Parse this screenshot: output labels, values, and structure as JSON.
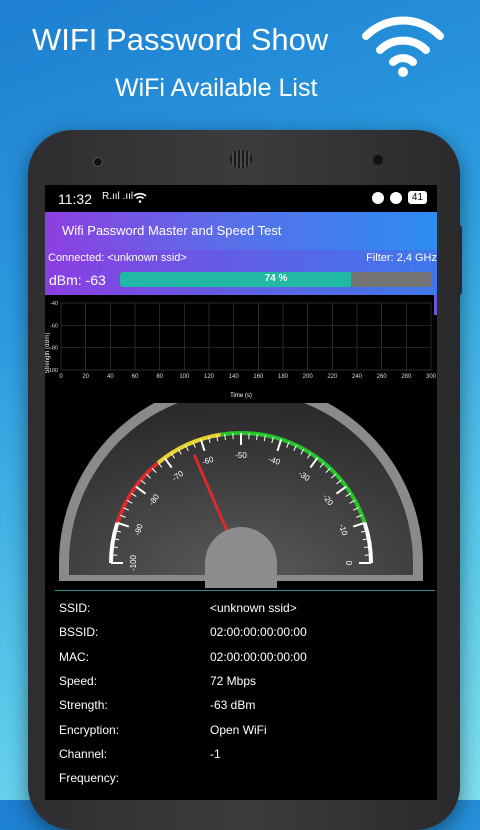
{
  "promo": {
    "title": "WIFI Password Show",
    "subtitle": "WiFi Available List"
  },
  "status_bar": {
    "time": "11:32",
    "left_icons": "R.ııl .ııl",
    "battery": "41"
  },
  "app": {
    "title": "Wifi Password Master and Speed Test"
  },
  "connection": {
    "connected_label": "Connected: <unknown ssid>",
    "filter_label": "Filter: 2,4 GHz",
    "dbm_label": "dBm: -63",
    "progress_text": "74 %",
    "progress_fraction": 0.74
  },
  "graph": {
    "ylabel": "Strength (dBm)",
    "xlabel": "Time (s)",
    "y_ticks": [
      "-40",
      "-60",
      "-80",
      "-100"
    ],
    "x_ticks": [
      "0",
      "20",
      "40",
      "60",
      "80",
      "100",
      "120",
      "140",
      "160",
      "180",
      "200",
      "220",
      "240",
      "260",
      "280",
      "300"
    ]
  },
  "gauge": {
    "ticks": [
      "-100",
      "-90",
      "-80",
      "-70",
      "-60",
      "-50",
      "-40",
      "-30",
      "-20",
      "-10",
      "0"
    ],
    "value": -63,
    "min": -100,
    "max": 0
  },
  "details": [
    {
      "label": "SSID:",
      "value": "<unknown ssid>"
    },
    {
      "label": "BSSID:",
      "value": "02:00:00:00:00:00"
    },
    {
      "label": "MAC:",
      "value": "02:00:00:00:00:00"
    },
    {
      "label": "Speed:",
      "value": "72 Mbps"
    },
    {
      "label": "Strength:",
      "value": "-63 dBm"
    },
    {
      "label": "Encryption:",
      "value": "Open WiFi"
    },
    {
      "label": "Channel:",
      "value": "-1"
    },
    {
      "label": "Frequency:",
      "value": ""
    }
  ],
  "colors": {
    "accent_teal": "#21b9a5",
    "gauge_red": "#d92b2b",
    "gauge_yellow": "#e8d32a",
    "gauge_green": "#27c52b"
  }
}
